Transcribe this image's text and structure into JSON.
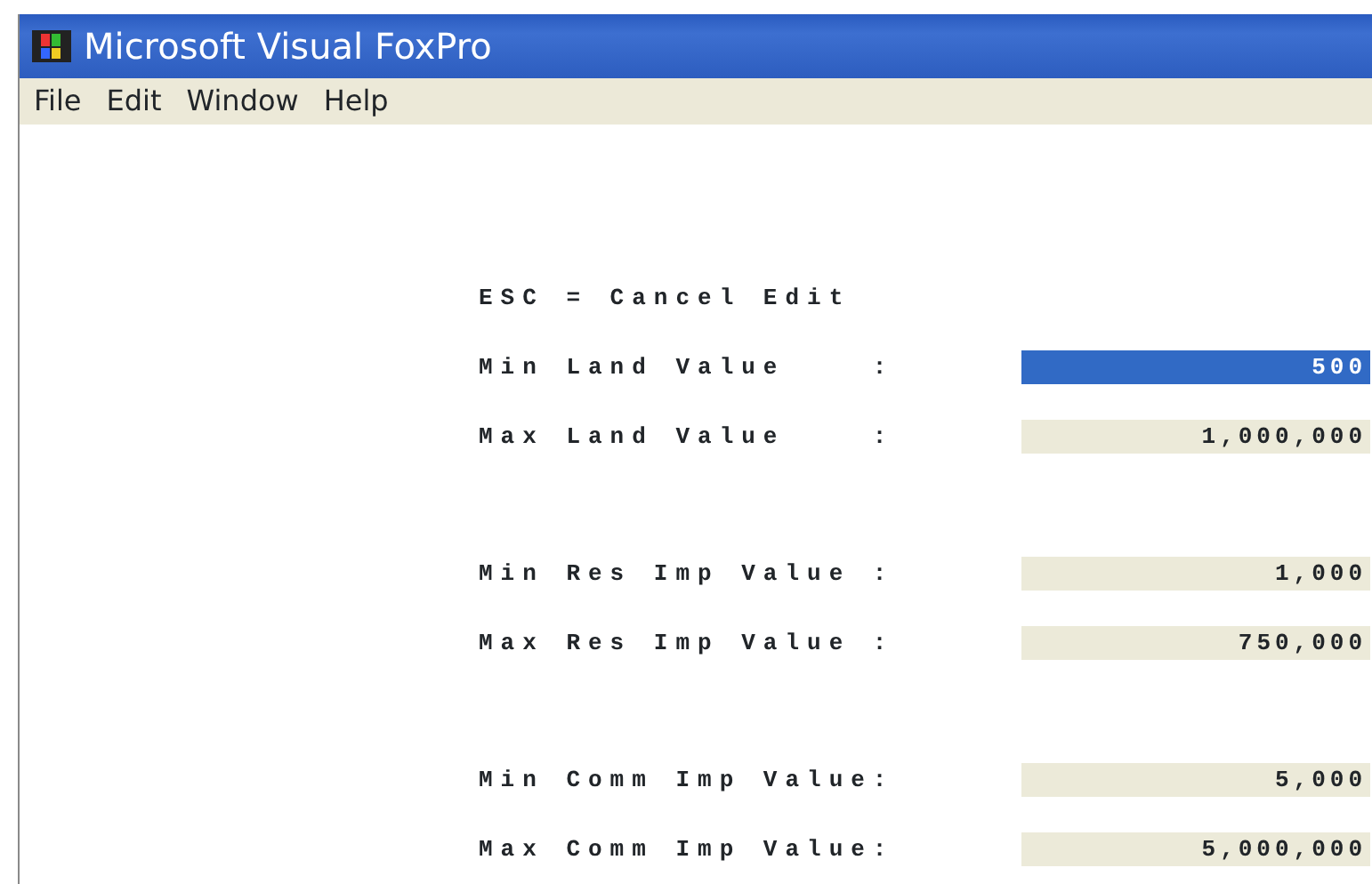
{
  "window": {
    "title": "Microsoft Visual FoxPro"
  },
  "menu": [
    "File",
    "Edit",
    "Window",
    "Help"
  ],
  "form": {
    "hint": "ESC = Cancel Edit",
    "groups": [
      {
        "fields": [
          {
            "label": "Min Land Value    :",
            "value": "500",
            "selected": true
          },
          {
            "label": "Max Land Value    :",
            "value": "1,000,000",
            "selected": false
          }
        ]
      },
      {
        "fields": [
          {
            "label": "Min Res Imp Value :",
            "value": "1,000",
            "selected": false
          },
          {
            "label": "Max Res Imp Value :",
            "value": "750,000",
            "selected": false
          }
        ]
      },
      {
        "fields": [
          {
            "label": "Min Comm Imp Value:",
            "value": "5,000",
            "selected": false
          },
          {
            "label": "Max Comm Imp Value:",
            "value": "5,000,000",
            "selected": false
          }
        ]
      }
    ]
  }
}
